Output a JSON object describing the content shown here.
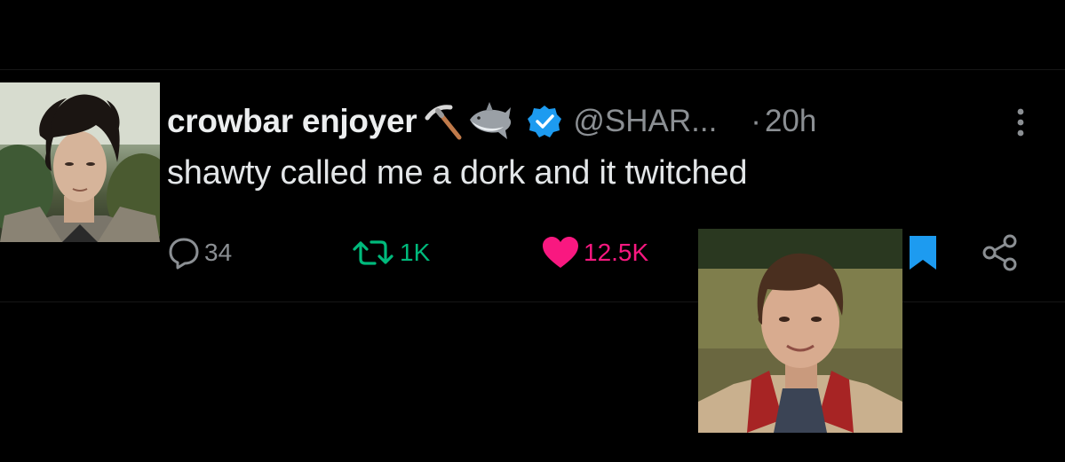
{
  "tweet": {
    "display_name": "crowbar enjoyer",
    "handle": "@SHAR...",
    "separator": "·",
    "timestamp": "20h",
    "text": "shawty called me a dork and it twitched"
  },
  "actions": {
    "replies": "34",
    "retweets": "1K",
    "likes": "12.5K"
  },
  "icons": {
    "name_emojis": [
      "pick-icon",
      "shark-icon"
    ],
    "verified": "verified-badge-icon",
    "more": "more-options-icon",
    "reply": "reply-icon",
    "retweet": "retweet-icon",
    "like": "heart-icon",
    "bookmark": "bookmark-icon",
    "share": "share-icon"
  },
  "colors": {
    "background": "#000000",
    "verified_blue": "#1d9bf0",
    "retweet_green": "#00ba7c",
    "like_pink": "#f91880",
    "muted_text": "#8b8f93"
  }
}
